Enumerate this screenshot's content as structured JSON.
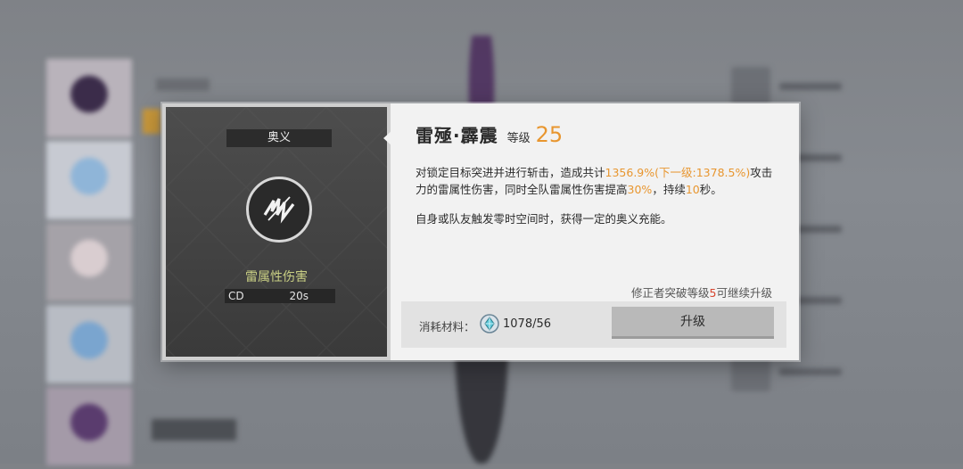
{
  "skill_panel": {
    "type_label": "奥义",
    "damage_type": "雷属性伤害",
    "cd_label": "CD",
    "cd_value": "20s",
    "icon": "lightning-slash-icon"
  },
  "skill_detail": {
    "name": "雷殛·霹震",
    "level_label": "等级",
    "level_value": "25",
    "desc1_a": "对锁定目标突进并进行斩击，造成共计",
    "desc1_h1": "1356.9%(下一级:1378.5%)",
    "desc1_b": "攻击力的雷属性伤害，同时全队雷属性伤害提高",
    "desc1_h2": "30%",
    "desc1_c": "，持续",
    "desc1_h3": "10",
    "desc1_d": "秒。",
    "desc2": "自身或队友触发零时空间时，获得一定的奥义充能。",
    "breakthrough_a": "修正者突破等级",
    "breakthrough_num": "5",
    "breakthrough_b": "可继续升级"
  },
  "cost": {
    "label": "消耗材料：",
    "count": "1078/56",
    "icon": "material-crystal-icon"
  },
  "upgrade_button": "升级",
  "colors": {
    "highlight": "#e8962f",
    "damage_type": "#c9cf84",
    "breakthrough_red": "#d8452f"
  }
}
